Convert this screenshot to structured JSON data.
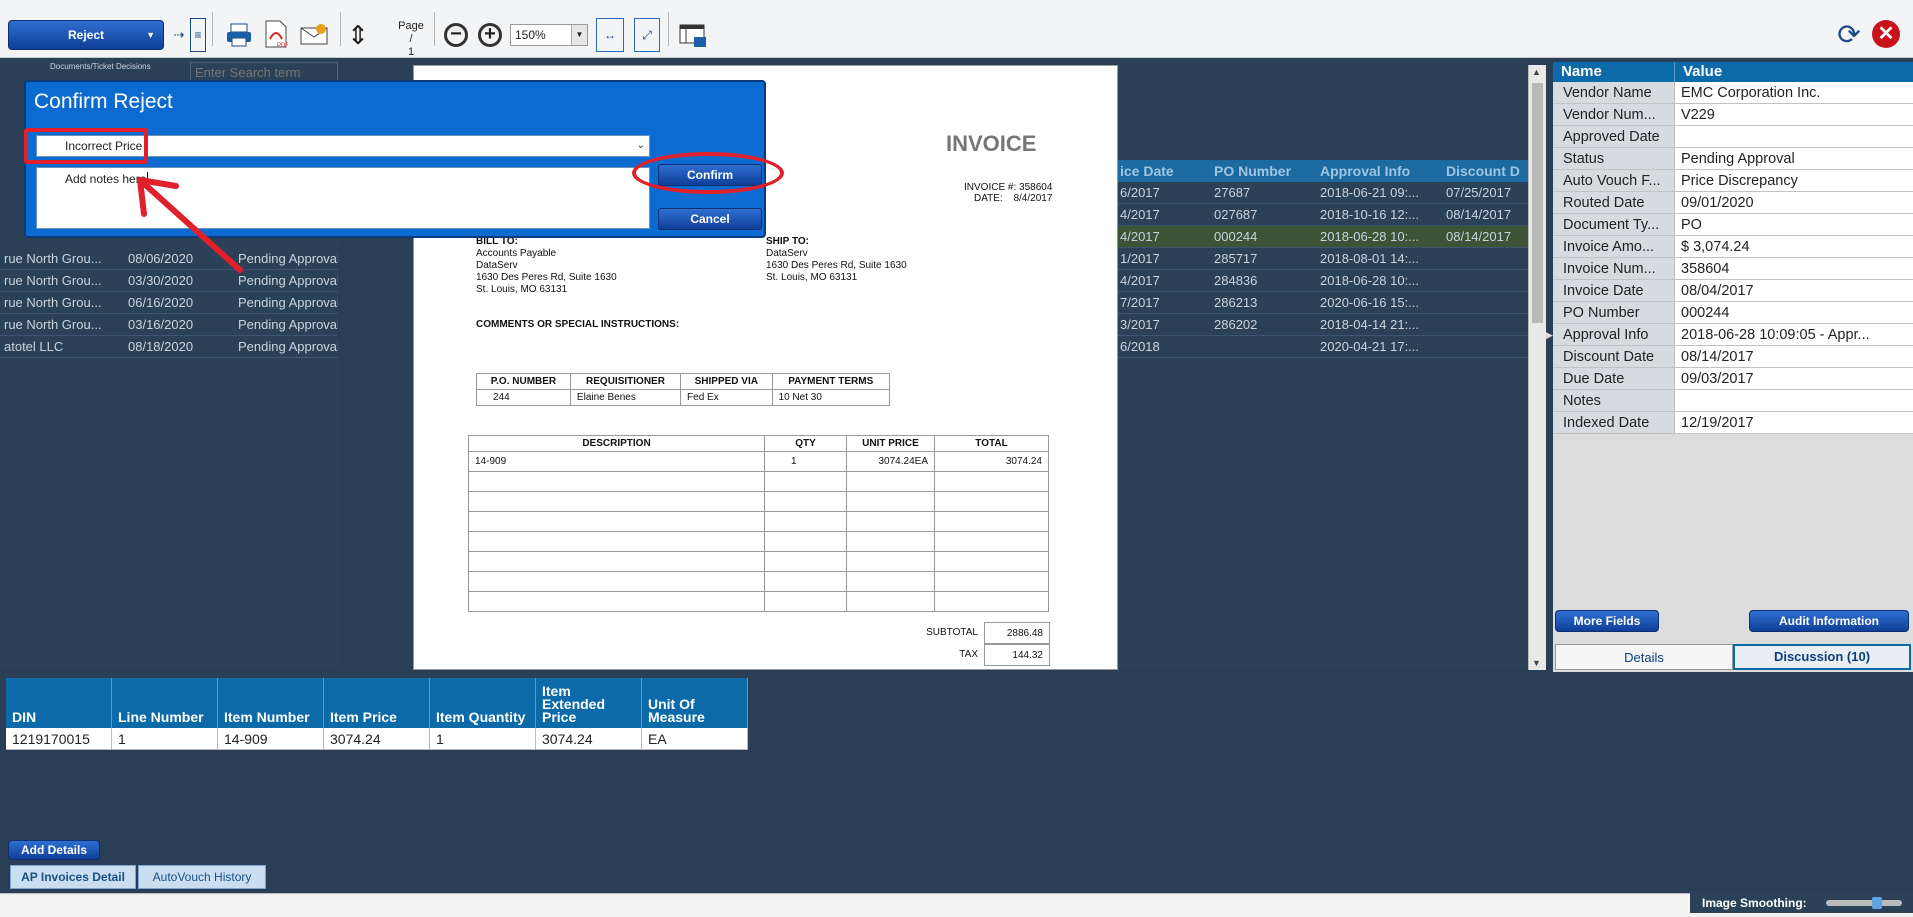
{
  "toolbar": {
    "reject_label": "Reject",
    "page_label": "Page",
    "page_sep": "/",
    "page_num": "1",
    "zoom_value": "150%"
  },
  "left_pane": {
    "stub_label": "Documents/Ticket Decisions",
    "search_placeholder": "Enter Search term",
    "rows": [
      {
        "vendor": "rue North Grou...",
        "date": "08/06/2020",
        "status": "Pending Approval"
      },
      {
        "vendor": "rue North Grou...",
        "date": "03/30/2020",
        "status": "Pending Approval"
      },
      {
        "vendor": "rue North Grou...",
        "date": "06/16/2020",
        "status": "Pending Approval"
      },
      {
        "vendor": "rue North Grou...",
        "date": "03/16/2020",
        "status": "Pending Approval"
      },
      {
        "vendor": "atotel LLC",
        "date": "08/18/2020",
        "status": "Pending Approval"
      }
    ]
  },
  "right_grid": {
    "headers": [
      "ice Date",
      "PO Number",
      "Approval Info",
      "Discount D"
    ],
    "rows": [
      [
        "6/2017",
        "27687",
        "2018-06-21 09:...",
        "07/25/2017"
      ],
      [
        "4/2017",
        "027687",
        "2018-10-16 12:...",
        "08/14/2017"
      ],
      [
        "4/2017",
        "000244",
        "2018-06-28 10:...",
        "08/14/2017"
      ],
      [
        "1/2017",
        "285717",
        "2018-08-01 14:...",
        ""
      ],
      [
        "4/2017",
        "284836",
        "2018-06-28 10:...",
        ""
      ],
      [
        "7/2017",
        "286213",
        "2020-06-16 15:...",
        ""
      ],
      [
        "3/2017",
        "286202",
        "2018-04-14 21:...",
        ""
      ],
      [
        "6/2018",
        "",
        "2020-04-21 17:...",
        ""
      ]
    ]
  },
  "invoice": {
    "title": "INVOICE",
    "invoice_no_label": "INVOICE #:",
    "invoice_no": "358604",
    "date_label": "DATE:",
    "date": "8/4/2017",
    "bill_to_label": "BILL TO:",
    "bill_to": [
      "Accounts Payable",
      "DataServ",
      "1630 Des Peres Rd, Suite 1630",
      "St. Louis, MO 63131"
    ],
    "ship_to_label": "SHIP TO:",
    "ship_to": [
      "DataServ",
      "1630 Des Peres Rd, Suite 1630",
      "St. Louis, MO 63131"
    ],
    "comments_label": "COMMENTS OR SPECIAL INSTRUCTIONS:",
    "po_headers": [
      "P.O. NUMBER",
      "REQUISITIONER",
      "SHIPPED VIA",
      "PAYMENT TERMS"
    ],
    "po_values": [
      "244",
      "Elaine Benes",
      "Fed Ex",
      "10 Net 30"
    ],
    "item_headers": [
      "DESCRIPTION",
      "QTY",
      "UNIT PRICE",
      "TOTAL"
    ],
    "item_row": [
      "14-909",
      "1",
      "3074.24EA",
      "3074.24"
    ],
    "subtotal_label": "SUBTOTAL",
    "subtotal": "2886.48",
    "tax_label": "TAX",
    "tax": "144.32"
  },
  "dialog": {
    "title": "Confirm Reject",
    "reason": "Incorrect Price",
    "notes": "Add notes here",
    "confirm_label": "Confirm",
    "cancel_label": "Cancel"
  },
  "properties": {
    "header_name": "Name",
    "header_value": "Value",
    "rows": [
      {
        "k": "Vendor Name",
        "v": "EMC Corporation Inc."
      },
      {
        "k": "Vendor Num...",
        "v": "V229"
      },
      {
        "k": "Approved Date",
        "v": ""
      },
      {
        "k": "Status",
        "v": "Pending Approval"
      },
      {
        "k": "Auto Vouch F...",
        "v": "Price Discrepancy"
      },
      {
        "k": "Routed Date",
        "v": "09/01/2020"
      },
      {
        "k": "Document Ty...",
        "v": "PO"
      },
      {
        "k": "Invoice Amo...",
        "v": "$ 3,074.24"
      },
      {
        "k": "Invoice Num...",
        "v": "358604"
      },
      {
        "k": "Invoice Date",
        "v": "08/04/2017"
      },
      {
        "k": "PO Number",
        "v": "000244"
      },
      {
        "k": "Approval Info",
        "v": "2018-06-28 10:09:05 - Appr..."
      },
      {
        "k": "Discount Date",
        "v": "08/14/2017"
      },
      {
        "k": "Due Date",
        "v": "09/03/2017"
      },
      {
        "k": "Notes",
        "v": ""
      },
      {
        "k": "Indexed Date",
        "v": "12/19/2017"
      }
    ],
    "more_fields_label": "More Fields",
    "audit_label": "Audit Information",
    "tab_details": "Details",
    "tab_discussion": "Discussion (10)"
  },
  "lines": {
    "headers": [
      "DIN",
      "Line Number",
      "Item Number",
      "Item Price",
      "Item Quantity",
      "Item Extended Price",
      "Unit Of Measure"
    ],
    "row": [
      "1219170015",
      "1",
      "14-909",
      "3074.24",
      "1",
      "3074.24",
      "EA"
    ]
  },
  "bottom": {
    "add_details_label": "Add Details",
    "tab_ap": "AP Invoices Detail",
    "tab_autovouch": "AutoVouch History",
    "smoothing_label": "Image Smoothing:"
  },
  "colors": {
    "accent": "#0c6aa8",
    "dialog": "#0c6bd1",
    "annotation": "#e0202a"
  }
}
